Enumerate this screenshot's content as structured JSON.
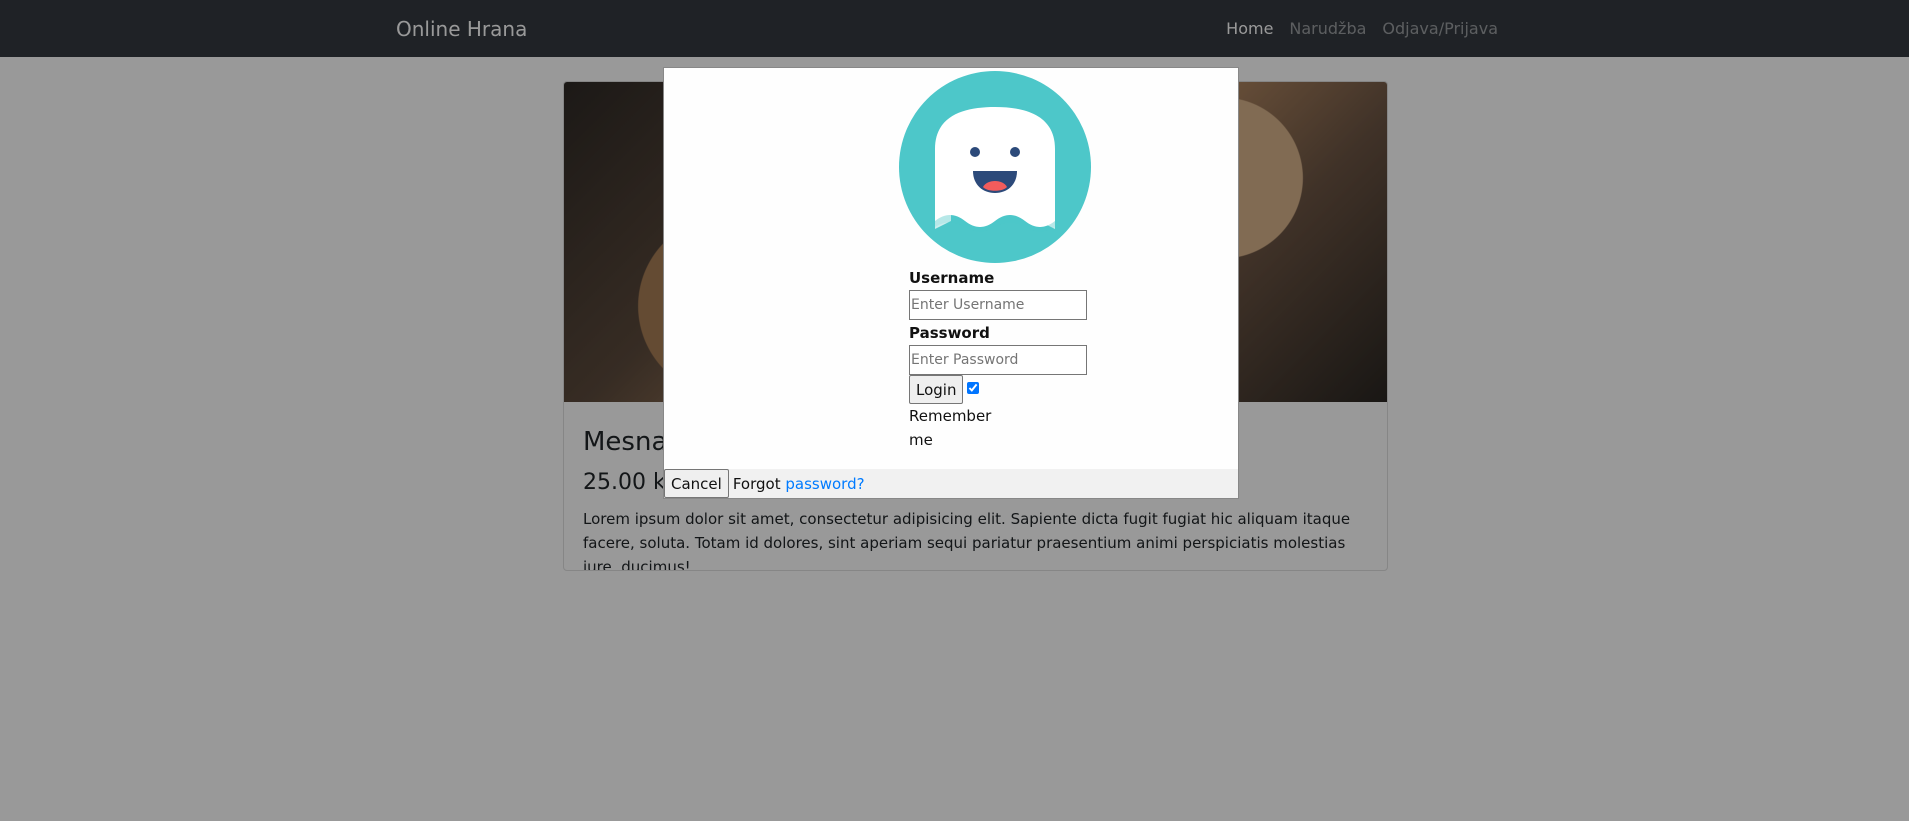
{
  "navbar": {
    "brand": "Online Hrana",
    "links": [
      {
        "label": "Home",
        "active": true
      },
      {
        "label": "Narudžba",
        "active": false
      },
      {
        "label": "Odjava/Prijava",
        "active": false
      }
    ]
  },
  "card": {
    "title": "Mesna",
    "price": "25.00 k",
    "text": "Lorem ipsum dolor sit amet, consectetur adipisicing elit. Sapiente dicta fugit fugiat hic aliquam itaque facere, soluta. Totam id dolores, sint aperiam sequi pariatur praesentium animi perspiciatis molestias iure, ducimus!"
  },
  "modal": {
    "avatar_icon": "ghost-avatar-icon",
    "username_label": "Username",
    "username_placeholder": "Enter Username",
    "password_label": "Password",
    "password_placeholder": "Enter Password",
    "login_label": "Login",
    "remember_checked": true,
    "remember_label": "Remember me",
    "cancel_label": "Cancel",
    "forgot_text": "Forgot",
    "forgot_link": "password?"
  },
  "colors": {
    "navbar_bg": "#343a40",
    "avatar_bg": "#4dc7c9",
    "link": "#007bff"
  }
}
